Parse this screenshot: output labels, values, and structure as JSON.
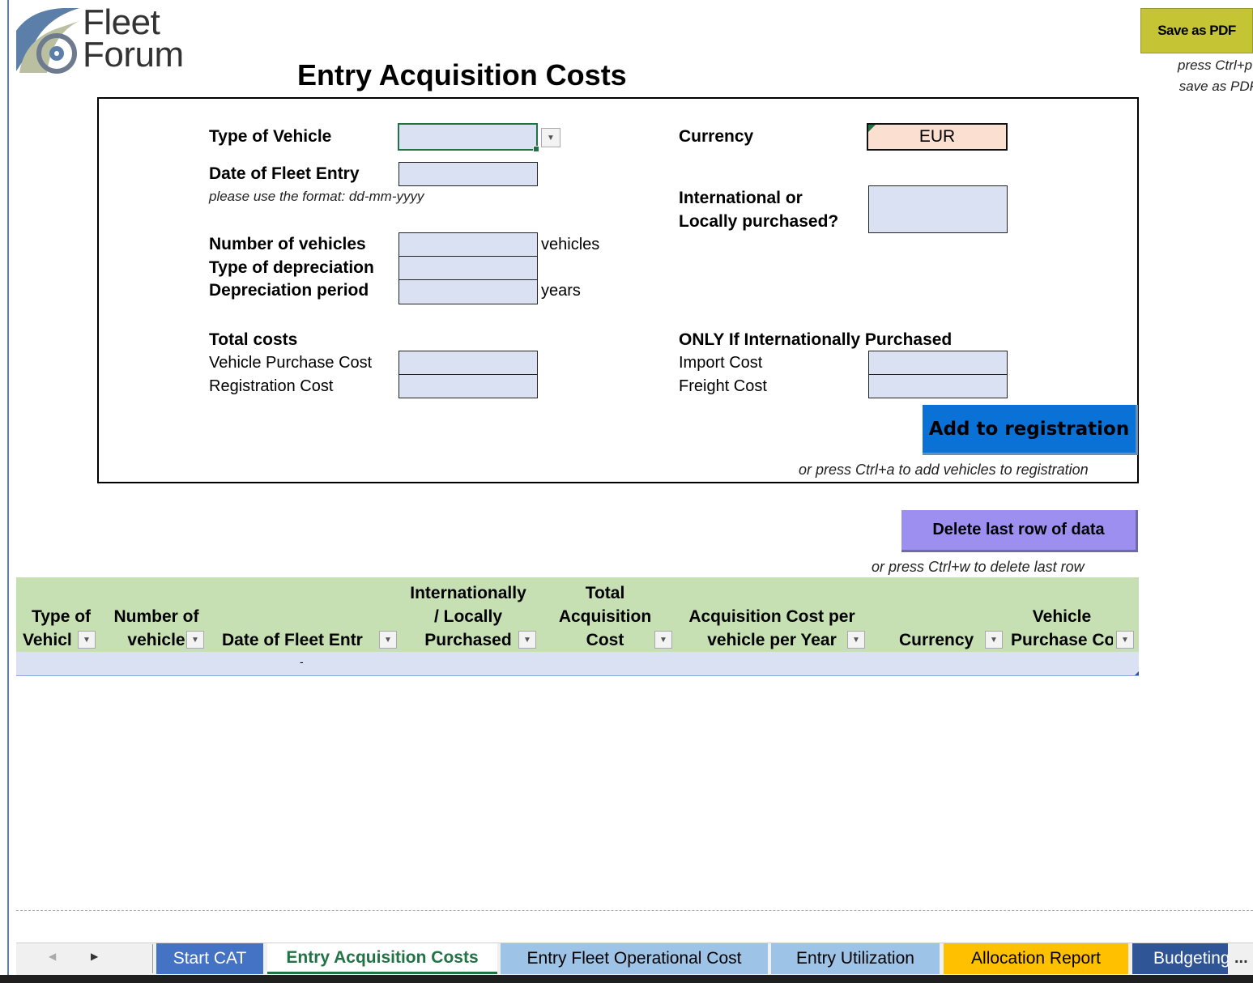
{
  "logo": {
    "line1": "Fleet",
    "line2": "Forum"
  },
  "title": "Entry Acquisition Costs",
  "save_pdf": {
    "label": "Save as PDF",
    "hint_line1": "press Ctrl+p to",
    "hint_line2": "save as PDF"
  },
  "form": {
    "type_of_vehicle": "Type of Vehicle",
    "date_of_fleet_entry": "Date of Fleet Entry",
    "date_hint": "please use the format: dd-mm-yyyy",
    "number_of_vehicles": "Number of vehicles",
    "vehicles_unit": "vehicles",
    "type_of_depreciation": "Type of depreciation",
    "depreciation_period": "Depreciation period",
    "years_unit": "years",
    "total_costs": "Total costs",
    "vehicle_purchase_cost": "Vehicle Purchase Cost",
    "registration_cost": "Registration Cost",
    "currency": "Currency",
    "currency_value": "EUR",
    "intl_or_local_line1": "International or",
    "intl_or_local_line2": "Locally purchased?",
    "only_if_intl": "ONLY If Internationally Purchased",
    "import_cost": "Import Cost",
    "freight_cost": "Freight Cost"
  },
  "buttons": {
    "add": "Add to registration",
    "add_hint": "or press Ctrl+a to add vehicles to registration",
    "delete": "Delete last row of data",
    "delete_hint": "or press Ctrl+w to delete last row"
  },
  "table": {
    "headers": [
      {
        "l1": "",
        "l2": "Type of",
        "l3": "Vehicl"
      },
      {
        "l1": "",
        "l2": "Number of",
        "l3": "vehicle"
      },
      {
        "l1": "",
        "l2": "",
        "l3": "Date of Fleet Entr"
      },
      {
        "l1": "Internationally",
        "l2": "/ Locally",
        "l3": "Purchased"
      },
      {
        "l1": "Total",
        "l2": "Acquisition",
        "l3": "Cost"
      },
      {
        "l1": "",
        "l2": "Acquisition Cost per",
        "l3": "vehicle per Year"
      },
      {
        "l1": "",
        "l2": "",
        "l3": "Currency"
      },
      {
        "l1": "",
        "l2": "Vehicle",
        "l3": "Purchase Co"
      }
    ],
    "row_placeholder": "-"
  },
  "sheet_tabs": [
    {
      "label": "Start CAT",
      "color": "#4472c4"
    },
    {
      "label": "Entry Acquisition Costs",
      "color": "#ffffff"
    },
    {
      "label": "Entry Fleet Operational Cost",
      "color": "#9dc3e6"
    },
    {
      "label": "Entry Utilization",
      "color": "#9dc3e6"
    },
    {
      "label": "Allocation Report",
      "color": "#ffc000"
    },
    {
      "label": "Budgeting",
      "color": "#2f5597"
    }
  ],
  "nav": {
    "prev": "◀",
    "next": "▶",
    "more": "..."
  }
}
